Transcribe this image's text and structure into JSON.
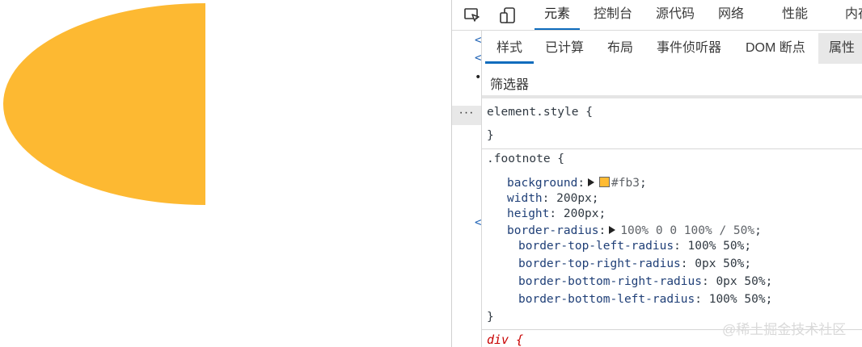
{
  "colors": {
    "shape": "#fdb932",
    "accent": "#0f6cbd"
  },
  "devtools": {
    "toolbar": {
      "inspect_icon": "inspect-element-icon",
      "device_icon": "device-emulation-icon",
      "tabs": [
        "元素",
        "控制台",
        "源代码",
        "网络",
        "性能",
        "内存"
      ]
    },
    "sub_tabs": [
      "样式",
      "已计算",
      "布局",
      "事件侦听器",
      "DOM 断点",
      "属性"
    ],
    "filter_placeholder": "筛选器",
    "dom_ellipsis": "···",
    "element_style": {
      "selector": "element.style {",
      "close": "}"
    },
    "rule": {
      "selector": ".footnote {",
      "background_prop": "background",
      "background_val": "#fb3",
      "width_prop": "width",
      "width_val": "200px",
      "height_prop": "height",
      "height_val": "200px",
      "radius_prop": "border-radius",
      "radius_val": "100% 0 0 100% / 50%",
      "longhands": [
        {
          "prop": "border-top-left-radius",
          "val": "100% 50%"
        },
        {
          "prop": "border-top-right-radius",
          "val": "0px 50%"
        },
        {
          "prop": "border-bottom-right-radius",
          "val": "0px 50%"
        },
        {
          "prop": "border-bottom-left-radius",
          "val": "100% 50%"
        }
      ],
      "close": "}"
    },
    "next_selector": "div {"
  },
  "watermark": "@稀土掘金技术社区"
}
